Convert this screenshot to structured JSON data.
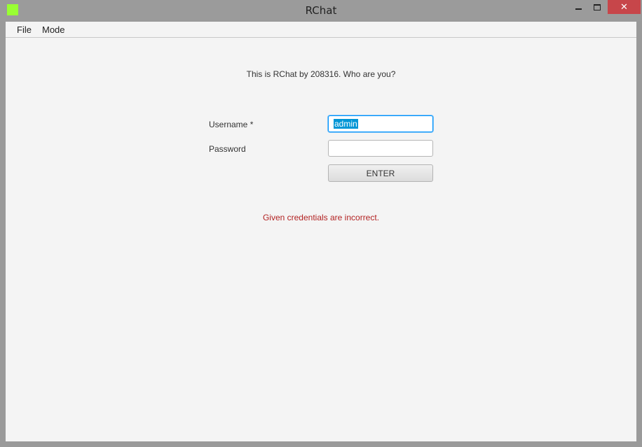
{
  "window": {
    "title": "RChat",
    "icon": "app-icon",
    "icon_color": "#99ff33",
    "close_color": "#c7464a"
  },
  "menu": {
    "items": [
      {
        "label": "File"
      },
      {
        "label": "Mode"
      }
    ]
  },
  "login": {
    "greeting": "This is RChat by 208316. Who are you?",
    "username_label": "Username *",
    "username_value": "admin",
    "password_label": "Password",
    "password_value": "",
    "enter_label": "ENTER",
    "error": "Given credentials are incorrect.",
    "error_color": "#b22222"
  }
}
